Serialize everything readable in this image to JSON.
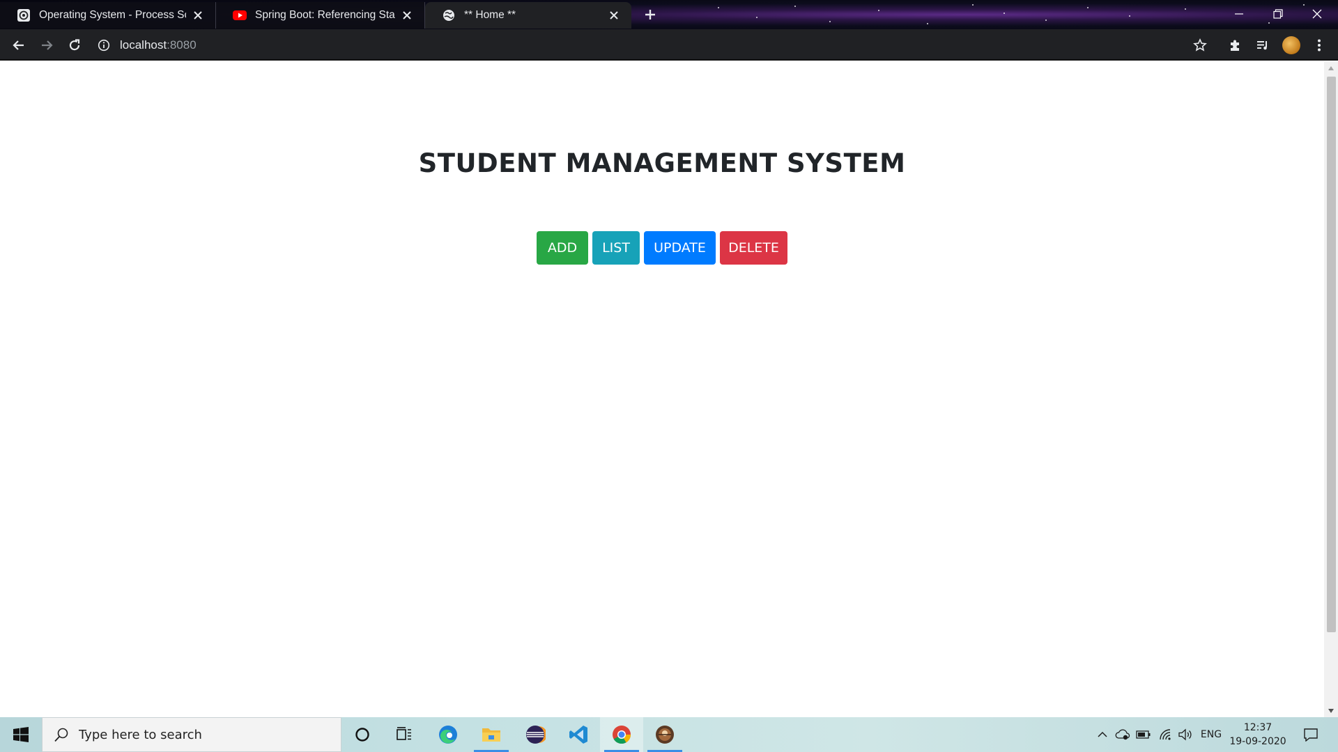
{
  "browser": {
    "tabs": [
      {
        "title": "Operating System - Process Sche",
        "icon": "globe-gear-icon",
        "active": false
      },
      {
        "title": "Spring Boot: Referencing Static C",
        "icon": "youtube-icon",
        "active": false
      },
      {
        "title": "** Home **",
        "icon": "globe-icon",
        "active": true
      }
    ],
    "url": {
      "host": "localhost",
      "port": ":8080"
    }
  },
  "page": {
    "title": "STUDENT MANAGEMENT SYSTEM",
    "buttons": [
      {
        "label": "ADD",
        "color": "#28a745"
      },
      {
        "label": "LIST",
        "color": "#17a2b8"
      },
      {
        "label": "UPDATE",
        "color": "#007bff"
      },
      {
        "label": "DELETE",
        "color": "#dc3545"
      }
    ]
  },
  "taskbar": {
    "search_placeholder": "Type here to search",
    "apps": [
      "cortana-icon",
      "task-view-icon",
      "edge-icon",
      "file-explorer-icon",
      "eclipse-icon",
      "vscode-icon",
      "chrome-icon",
      "app-icon"
    ],
    "language": "ENG",
    "time": "12:37",
    "date": "19-09-2020"
  },
  "colors": {
    "tab_bar_bg": "#202124",
    "page_bg": "#ffffff",
    "title_text": "#212529"
  }
}
